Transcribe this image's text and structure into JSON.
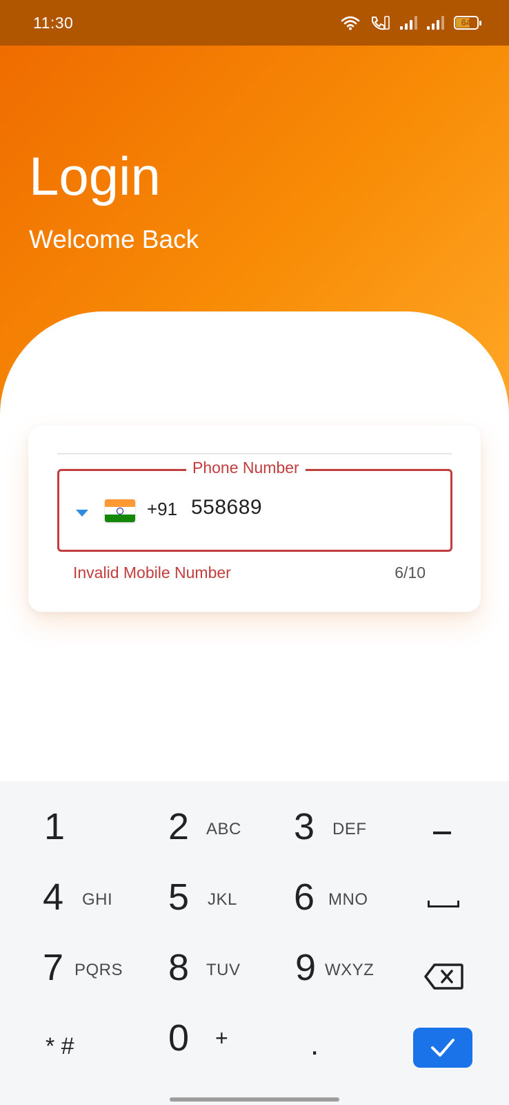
{
  "status_bar": {
    "time": "11:30",
    "battery": "64"
  },
  "header": {
    "title": "Login",
    "subtitle": "Welcome Back"
  },
  "phone_field": {
    "label": "Phone Number",
    "country_code": "+91",
    "country_flag": "india-flag",
    "value": "558689",
    "error": "Invalid Mobile Number",
    "counter": "6/10"
  },
  "keyboard": {
    "keys": [
      {
        "digit": "1",
        "letters": ""
      },
      {
        "digit": "2",
        "letters": "ABC"
      },
      {
        "digit": "3",
        "letters": "DEF"
      },
      {
        "digit": "4",
        "letters": "GHI"
      },
      {
        "digit": "5",
        "letters": "JKL"
      },
      {
        "digit": "6",
        "letters": "MNO"
      },
      {
        "digit": "7",
        "letters": "PQRS"
      },
      {
        "digit": "8",
        "letters": "TUV"
      },
      {
        "digit": "9",
        "letters": "WXYZ"
      },
      {
        "digit": "* #",
        "letters": ""
      },
      {
        "digit": "0",
        "letters": "+"
      },
      {
        "digit": ".",
        "letters": ""
      }
    ],
    "accent_color": "#1a73e8"
  },
  "colors": {
    "header_start": "#ef6c00",
    "header_end": "#ffa726",
    "error": "#c23d3d"
  }
}
